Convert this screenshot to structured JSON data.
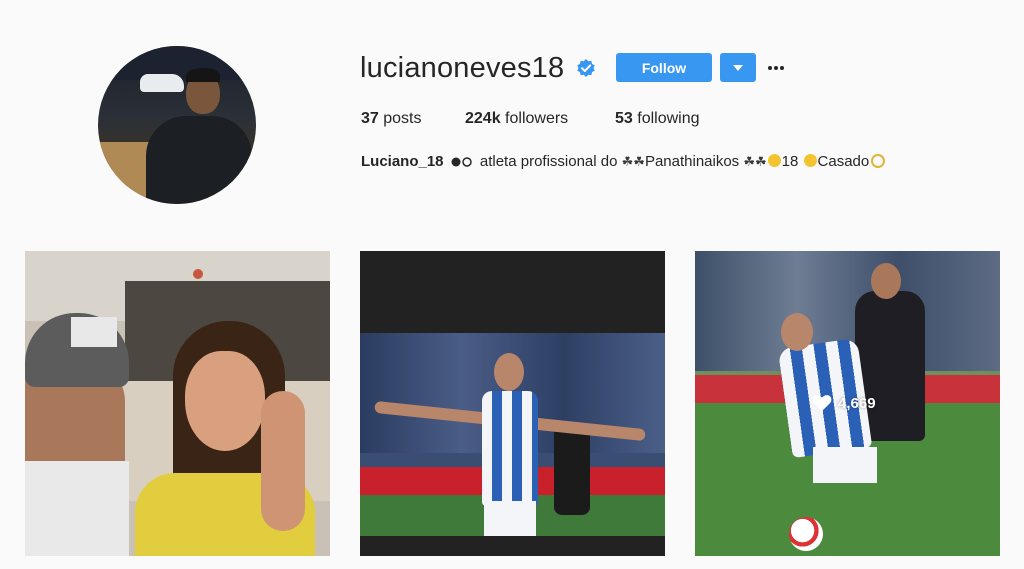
{
  "profile": {
    "username": "lucianoneves18",
    "verified": true,
    "follow_label": "Follow",
    "stats": {
      "posts_count": "37",
      "posts_label": "posts",
      "followers_count": "224k",
      "followers_label": "followers",
      "following_count": "53",
      "following_label": "following"
    },
    "bio": {
      "name": "Luciano_18",
      "text_1": "atleta profissional do",
      "team": "Panathinaikos",
      "number": "18",
      "status": "Casado"
    }
  },
  "posts": [
    {
      "type": "photo",
      "subject": "selfie"
    },
    {
      "type": "photo",
      "subject": "football celebration"
    },
    {
      "type": "photo",
      "subject": "football match",
      "likes": "4,669"
    }
  ],
  "colors": {
    "accent": "#3897f0",
    "background": "#fafafa",
    "text": "#262626"
  }
}
